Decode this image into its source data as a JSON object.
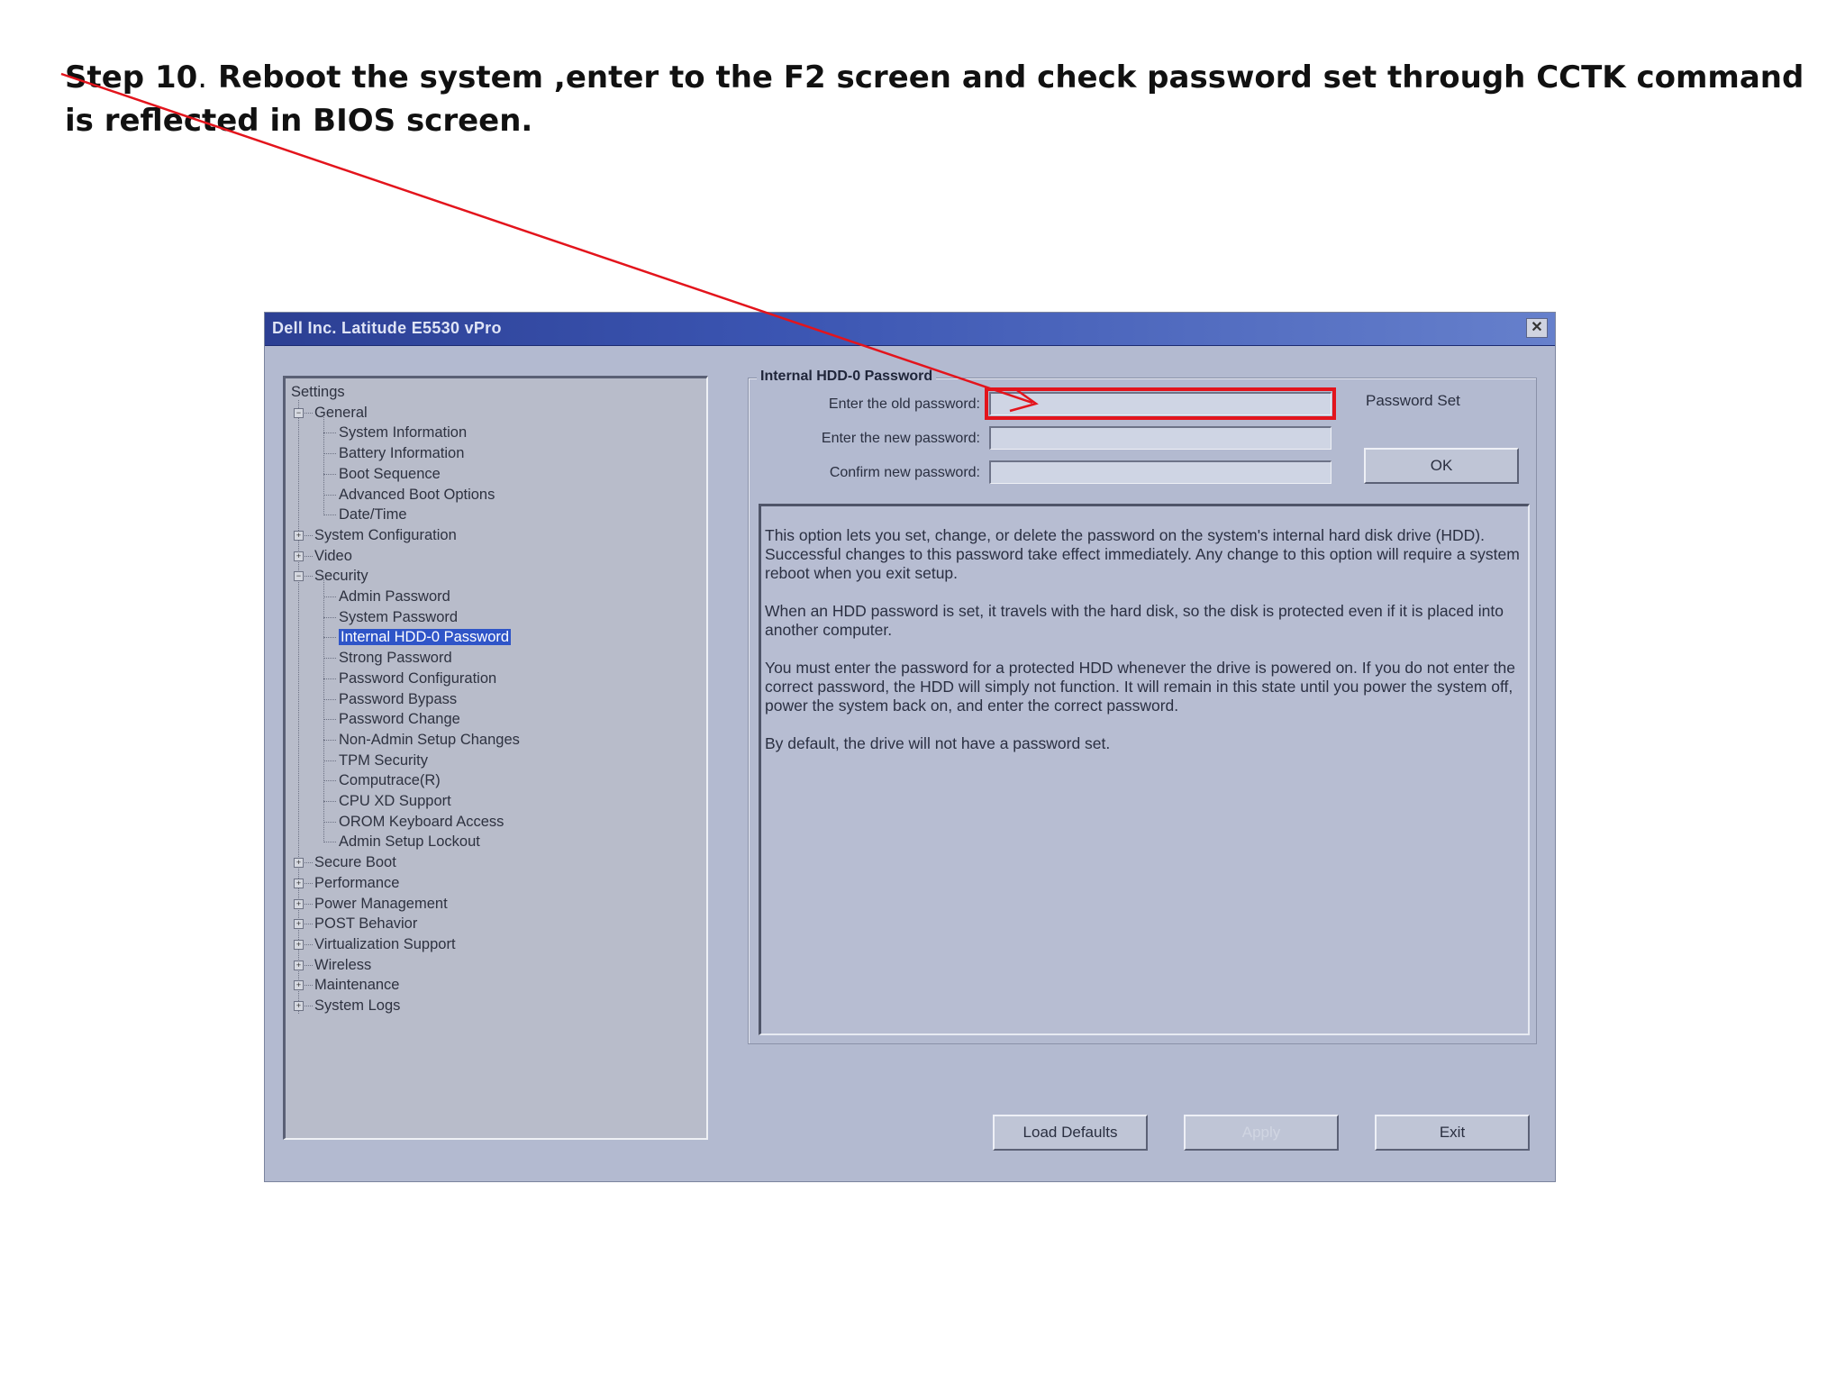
{
  "instruction": {
    "step_label": "Step 10",
    "dot": ".",
    "text": " Reboot the system  ,enter to the F2 screen and check password set  through CCTK command is reflected in BIOS screen."
  },
  "window": {
    "title": "Dell Inc. Latitude E5530 vPro",
    "close_label": "✕"
  },
  "tree": {
    "root": "Settings",
    "items": [
      {
        "label": "General",
        "level": 1,
        "expander": "−"
      },
      {
        "label": "System Information",
        "level": 2
      },
      {
        "label": "Battery Information",
        "level": 2
      },
      {
        "label": "Boot Sequence",
        "level": 2
      },
      {
        "label": "Advanced Boot Options",
        "level": 2
      },
      {
        "label": "Date/Time",
        "level": 2
      },
      {
        "label": "System Configuration",
        "level": 1,
        "expander": "+"
      },
      {
        "label": "Video",
        "level": 1,
        "expander": "+"
      },
      {
        "label": "Security",
        "level": 1,
        "expander": "−"
      },
      {
        "label": "Admin Password",
        "level": 2
      },
      {
        "label": "System Password",
        "level": 2
      },
      {
        "label": "Internal HDD-0 Password",
        "level": 2,
        "selected": true
      },
      {
        "label": "Strong Password",
        "level": 2
      },
      {
        "label": "Password Configuration",
        "level": 2
      },
      {
        "label": "Password Bypass",
        "level": 2
      },
      {
        "label": "Password Change",
        "level": 2
      },
      {
        "label": "Non-Admin Setup Changes",
        "level": 2
      },
      {
        "label": "TPM Security",
        "level": 2
      },
      {
        "label": "Computrace(R)",
        "level": 2
      },
      {
        "label": "CPU XD Support",
        "level": 2
      },
      {
        "label": "OROM Keyboard Access",
        "level": 2
      },
      {
        "label": "Admin Setup Lockout",
        "level": 2
      },
      {
        "label": "Secure Boot",
        "level": 1,
        "expander": "+"
      },
      {
        "label": "Performance",
        "level": 1,
        "expander": "+"
      },
      {
        "label": "Power Management",
        "level": 1,
        "expander": "+"
      },
      {
        "label": "POST Behavior",
        "level": 1,
        "expander": "+"
      },
      {
        "label": "Virtualization Support",
        "level": 1,
        "expander": "+"
      },
      {
        "label": "Wireless",
        "level": 1,
        "expander": "+"
      },
      {
        "label": "Maintenance",
        "level": 1,
        "expander": "+"
      },
      {
        "label": "System Logs",
        "level": 1,
        "expander": "+"
      }
    ]
  },
  "password_panel": {
    "group_title": "Internal HDD-0 Password",
    "old_label": "Enter the old password:",
    "new_label": "Enter the new password:",
    "confirm_label": "Confirm new password:",
    "old_value": "",
    "new_value": "",
    "confirm_value": "",
    "status": "Password Set",
    "ok_label": "OK"
  },
  "description": {
    "p1": "This option lets you set, change, or delete the password on the system's internal  hard disk drive (HDD).",
    "p1b": "Successful changes to this password take effect immediately. Any change to this option will require a system reboot when you exit setup.",
    "p2": "When an HDD password is set, it travels with the hard disk, so the disk is protected even if it is placed into another computer.",
    "p3": "You must enter the password for a protected HDD whenever the drive is powered on.  If you do not enter the correct password, the HDD will simply not function. It will remain in this state until you power the system off, power the system back on, and enter the correct password.",
    "p4": "By default, the drive will not have a password set."
  },
  "buttons": {
    "load_defaults": "Load Defaults",
    "apply": "Apply",
    "exit": "Exit"
  },
  "colors": {
    "annotation_red": "#e3141c",
    "title_bar_blue": "#2c3f93",
    "selection_blue": "#2f55c8"
  }
}
